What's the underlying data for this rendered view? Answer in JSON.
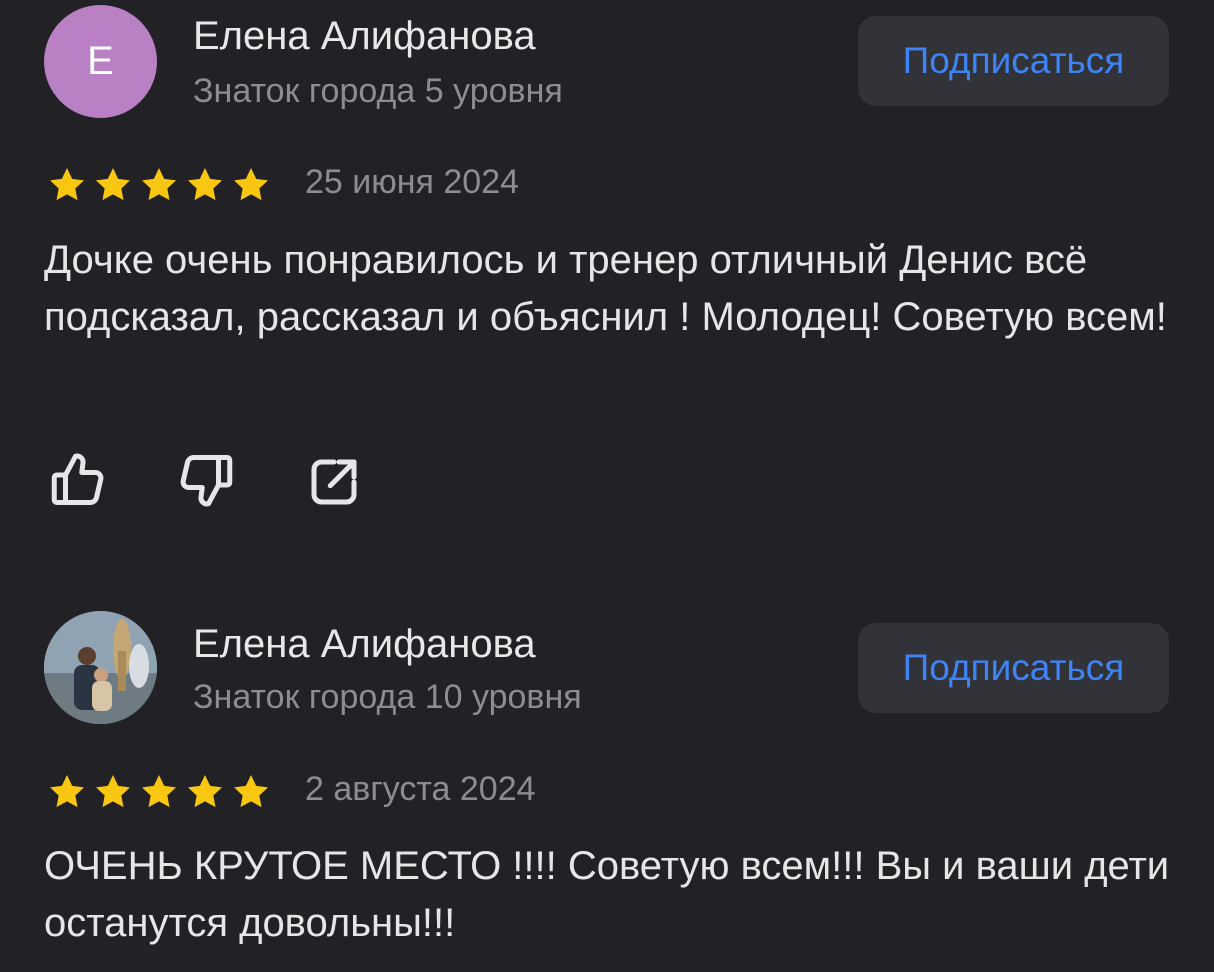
{
  "reviews": [
    {
      "author": {
        "name": "Елена Алифанова",
        "level": "Знаток города 5 уровня",
        "avatar_letter": "Е",
        "avatar_color": "#b981c3"
      },
      "subscribe_label": "Подписаться",
      "rating": 5,
      "date": "25 июня 2024",
      "text": "Дочке очень понравилось и тренер отличный Денис всё подсказал, рассказал и объяснил ! Молодец! Советую всем!",
      "actions": [
        "thumbs-up-icon",
        "thumbs-down-icon",
        "share-icon"
      ]
    },
    {
      "author": {
        "name": "Елена Алифанова",
        "level": "Знаток города 10 уровня"
      },
      "subscribe_label": "Подписаться",
      "rating": 5,
      "date": "2 августа 2024",
      "text": "ОЧЕНЬ КРУТОЕ МЕСТО !!!! Советую всем!!! Вы и ваши дети останутся довольны!!!"
    }
  ],
  "colors": {
    "background": "#222226",
    "accent": "#3f84f5",
    "star": "#f9c712",
    "button_bg": "#323338",
    "muted_text": "#8c8c92"
  }
}
